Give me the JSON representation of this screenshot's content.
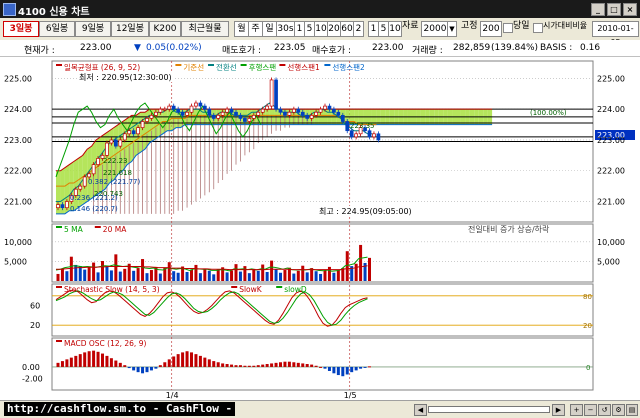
{
  "window": {
    "title": "4100 신용 차트"
  },
  "toolbar": {
    "tabs": [
      "3일봉",
      "6일봉",
      "9일봉",
      "12일봉",
      "K200",
      "최근월물"
    ],
    "period_buttons": [
      "월",
      "주",
      "일",
      "30s",
      "1",
      "5",
      "10",
      "20",
      "60",
      "2"
    ],
    "range_buttons": [
      "1",
      "5",
      "10"
    ],
    "count_label": "자료",
    "count_value": "2000",
    "fixed_label": "고정",
    "fixed_value": "200",
    "today_label": "당일",
    "compare_label": "시가대비비율",
    "date_value": "2010-01-05"
  },
  "info": {
    "current_label": "현재가 :",
    "current_value": "223.00",
    "change_value": "0.05(0.02%)",
    "sell_label": "매도호가 :",
    "sell_value": "223.05",
    "buy_label": "매수호가 :",
    "buy_value": "223.00",
    "volume_label": "거래량 :",
    "volume_value": "282,859",
    "volume_pct": "(139.84%)",
    "basis_label": "BASIS :",
    "basis_value": "0.16"
  },
  "legend": {
    "main": [
      {
        "name": "일목균형표 (26, 9, 52)",
        "color": "#c00000"
      },
      {
        "name": "기준선",
        "color": "#e08000"
      },
      {
        "name": "전환선",
        "color": "#008080"
      },
      {
        "name": "후행스팬",
        "color": "#00a000"
      },
      {
        "name": "선행스팬1",
        "color": "#c00000"
      },
      {
        "name": "선행스팬2",
        "color": "#0066cc"
      }
    ],
    "volume": [
      {
        "name": "5 MA",
        "color": "#00a000"
      },
      {
        "name": "20 MA",
        "color": "#c00000"
      }
    ],
    "volume_note": "전일대비 증가 상승/하락",
    "stoch": [
      {
        "name": "Stochastic Slow (14, 5, 3)",
        "color": "#c00000"
      },
      {
        "name": "SlowK",
        "color": "#c00000"
      },
      {
        "name": "slowD",
        "color": "#00a000"
      }
    ],
    "macd": [
      {
        "name": "MACD OSC (12, 26, 9)",
        "color": "#c00000"
      }
    ]
  },
  "annotations": {
    "high": "최고 : 224.95(09:05:00)",
    "low": "최저 : 220.95(12:30:00)",
    "cloud_labels": [
      "222.23",
      "221.618",
      "220.743",
      "223.35"
    ],
    "fib_labels": [
      "0.382 (221.77)",
      "0.236 (221.2)",
      "0.146 (220.7)"
    ],
    "right_box_label": "(100.00%)"
  },
  "price_badge": "223.00",
  "axes": {
    "price_ticks": [
      "225.00",
      "224.00",
      "223.00",
      "222.00",
      "221.00"
    ],
    "volume_ticks": [
      "10,000",
      "5,000"
    ],
    "stoch_ticks": [
      "60",
      "20"
    ],
    "stoch_levels": [
      "80",
      "20"
    ],
    "macd_ticks": [
      "0.00",
      "-2.00"
    ],
    "macd_zero": "0",
    "date_ticks": [
      "1/4",
      "1/5"
    ]
  },
  "statusbar": {
    "watermark": "http://cashflow.sm.to - CashFlow -"
  },
  "colors": {
    "background": "#ffffff",
    "cloud_fill": "#a8e040",
    "cloud_neg": "#b07878",
    "candle_up": "#c00000",
    "candle_down": "#0040c0",
    "grid": "#b0b0b0"
  },
  "chart_data": [
    {
      "type": "candlestick",
      "title": "일목균형표 (26, 9, 52)",
      "yticks": [
        221,
        222,
        223,
        224,
        225
      ],
      "ylim": [
        220.4,
        225.5
      ],
      "x_range": [
        0,
        120
      ],
      "date_ticks": [
        {
          "x": 26,
          "label": "1/4"
        },
        {
          "x": 66,
          "label": "1/5"
        }
      ],
      "horizontal_lines": [
        224.0,
        223.75,
        223.55,
        223.1,
        222.95
      ],
      "price_close": [
        220.9,
        220.8,
        221.0,
        221.2,
        221.4,
        221.5,
        221.8,
        221.9,
        222.2,
        222.4,
        222.5,
        222.9,
        223.0,
        222.8,
        223.0,
        223.2,
        223.3,
        223.2,
        223.4,
        223.6,
        223.7,
        223.8,
        223.9,
        224.0,
        224.0,
        224.1,
        224.0,
        223.9,
        223.8,
        223.9,
        224.1,
        224.2,
        224.1,
        224.0,
        223.8,
        223.7,
        223.8,
        223.9,
        224.0,
        223.9,
        223.8,
        223.7,
        223.6,
        223.7,
        223.8,
        223.9,
        224.0,
        224.1,
        224.95,
        224.0,
        223.9,
        223.8,
        223.9,
        224.0,
        223.9,
        223.8,
        223.7,
        223.8,
        223.9,
        224.0,
        224.1,
        224.0,
        223.9,
        223.8,
        223.6,
        223.3,
        223.1,
        223.2,
        223.4,
        223.3,
        223.1,
        223.2,
        223.0
      ],
      "tenkan": [
        221.0,
        221.0,
        221.1,
        221.2,
        221.4,
        221.5,
        221.7,
        221.9,
        222.1,
        222.3,
        222.5,
        222.7,
        222.9,
        223.0,
        223.1,
        223.2,
        223.3,
        223.4,
        223.5,
        223.6,
        223.7,
        223.8,
        223.8,
        223.9,
        223.9,
        224.0,
        224.0,
        223.9,
        223.9,
        223.9,
        224.0,
        224.0,
        224.0,
        223.9,
        223.9,
        223.8,
        223.8,
        223.9,
        223.9,
        223.9,
        223.8,
        223.8,
        223.8,
        223.8,
        223.9,
        223.9,
        224.0,
        224.1,
        224.2,
        224.1,
        224.0,
        223.9,
        223.9,
        223.9,
        223.9,
        223.8,
        223.8,
        223.8,
        223.9,
        223.9,
        224.0,
        223.9,
        223.9,
        223.8,
        223.7,
        223.5,
        223.4,
        223.3,
        223.3,
        223.3,
        223.2,
        223.2,
        223.1
      ],
      "kijun": [
        221.5,
        221.5,
        221.5,
        221.6,
        221.6,
        221.7,
        221.8,
        221.9,
        222.0,
        222.1,
        222.2,
        222.3,
        222.4,
        222.5,
        222.6,
        222.7,
        222.8,
        222.9,
        223.0,
        223.1,
        223.2,
        223.3,
        223.4,
        223.5,
        223.6,
        223.6,
        223.7,
        223.7,
        223.7,
        223.7,
        223.8,
        223.8,
        223.8,
        223.8,
        223.8,
        223.8,
        223.8,
        223.8,
        223.8,
        223.8,
        223.8,
        223.8,
        223.8,
        223.8,
        223.8,
        223.8,
        223.8,
        223.8,
        223.8,
        223.8,
        223.8,
        223.8,
        223.8,
        223.8,
        223.8,
        223.8,
        223.8,
        223.8,
        223.8,
        223.8,
        223.8,
        223.8,
        223.8,
        223.8,
        223.7,
        223.6,
        223.6,
        223.6,
        223.5,
        223.5,
        223.5,
        223.5,
        223.5
      ],
      "chikou": [
        221.8,
        222.2,
        222.6,
        223.0,
        223.5,
        223.9,
        224.0,
        224.1,
        223.9,
        223.6,
        223.4,
        223.5,
        223.8,
        224.0,
        223.7,
        223.5,
        223.3,
        223.6,
        223.9,
        224.1,
        224.2,
        224.0,
        223.8,
        223.6,
        223.4,
        223.6,
        223.9,
        224.0,
        223.8,
        223.5,
        223.3,
        223.6,
        223.9,
        224.1,
        223.8,
        223.5,
        223.2,
        223.4,
        223.7,
        223.9,
        223.6,
        223.3,
        223.1,
        223.3,
        223.6,
        223.8,
        223.5
      ],
      "span_a": [
        222.0,
        222.0,
        222.1,
        222.2,
        222.3,
        222.4,
        222.5,
        222.7,
        222.8,
        223.0,
        223.1,
        223.2,
        223.3,
        223.4,
        223.5,
        223.6,
        223.7,
        223.8,
        223.8,
        223.9,
        223.9,
        224.0,
        224.0,
        224.0,
        224.0,
        224.0,
        224.0,
        224.0,
        224.0,
        224.0,
        224.0,
        224.0,
        224.0,
        224.0,
        224.0,
        224.0,
        224.0,
        224.0,
        224.0,
        224.0,
        224.0,
        224.0,
        224.0,
        224.0,
        224.0,
        224.0,
        224.0,
        224.0,
        224.0,
        224.0,
        224.0,
        224.0,
        224.0,
        224.0,
        224.0,
        224.0,
        224.0,
        224.0,
        224.0,
        224.0,
        224.0,
        224.0,
        224.0,
        224.0,
        224.0,
        224.0,
        224.0,
        224.0,
        224.0,
        224.0,
        224.0,
        224.0,
        224.0,
        224.0,
        224.0,
        224.0,
        224.0,
        224.0,
        224.0,
        224.0,
        224.0,
        224.0,
        224.0,
        224.0,
        224.0,
        224.0,
        224.0,
        224.0,
        224.0,
        224.0,
        224.0,
        224.0,
        224.0,
        224.0,
        224.0,
        224.0,
        224.0,
        224.0,
        224.0
      ],
      "span_b": [
        220.6,
        220.6,
        220.6,
        220.7,
        220.7,
        220.8,
        220.9,
        221.0,
        221.1,
        221.2,
        221.3,
        221.4,
        221.6,
        221.7,
        221.9,
        222.0,
        222.2,
        222.3,
        222.5,
        222.6,
        222.7,
        222.9,
        223.0,
        223.1,
        223.2,
        223.3,
        223.3,
        223.4,
        223.4,
        223.5,
        223.5,
        223.5,
        223.5,
        223.5,
        223.5,
        223.5,
        223.5,
        223.5,
        223.5,
        223.5,
        223.5,
        223.5,
        223.5,
        223.5,
        223.5,
        223.5,
        223.5,
        223.5,
        223.5,
        223.5,
        223.5,
        223.5,
        223.5,
        223.5,
        223.5,
        223.5,
        223.5,
        223.5,
        223.5,
        223.5,
        223.5,
        223.5,
        223.5,
        223.5,
        223.5,
        223.5,
        223.5,
        223.5,
        223.5,
        223.5,
        223.5,
        223.5,
        223.5,
        223.5,
        223.5,
        223.5,
        223.5,
        223.5,
        223.5,
        223.5,
        223.5,
        223.5,
        223.5,
        223.5,
        223.5,
        223.5,
        223.5,
        223.5,
        223.5,
        223.5,
        223.5,
        223.5,
        223.5,
        223.5,
        223.5,
        223.5,
        223.5,
        223.5,
        223.5
      ]
    },
    {
      "type": "bar",
      "title": "volume",
      "yticks": [
        5000,
        10000
      ],
      "ylim": [
        0,
        12500
      ],
      "values": [
        1800,
        3200,
        2500,
        6200,
        4100,
        3800,
        2900,
        3500,
        4700,
        2200,
        5100,
        3900,
        2700,
        6800,
        2400,
        3100,
        4400,
        2600,
        3300,
        5600,
        2000,
        2800,
        3600,
        1900,
        3400,
        4800,
        2500,
        2100,
        3700,
        2300,
        2900,
        4100,
        2000,
        3200,
        2600,
        1700,
        2900,
        3500,
        2200,
        2700,
        4300,
        2400,
        3800,
        2000,
        3100,
        2600,
        4200,
        2300,
        5200,
        3000,
        2100,
        2800,
        3400,
        1900,
        2600,
        3900,
        2200,
        3300,
        2500,
        1800,
        2700,
        3600,
        2100,
        2900,
        3300,
        7600,
        3800,
        4400,
        9200,
        4600,
        5900
      ],
      "ma5": [
        2800,
        3000,
        3400,
        3600,
        3900,
        3800,
        3600,
        3700,
        3600,
        3500,
        3700,
        3900,
        3800,
        4100,
        3900,
        3700,
        3800,
        3600,
        3400,
        3700,
        3300,
        3200,
        3300,
        2900,
        2800,
        3300,
        3200,
        3000,
        3200,
        3100,
        2700,
        3100,
        3100,
        3000,
        3000,
        2700,
        2700,
        2900,
        2800,
        2600,
        3100,
        3000,
        3100,
        2900,
        3100,
        2800,
        3100,
        3000,
        3500,
        3500,
        3300,
        3000,
        3300,
        2900,
        2800,
        2900,
        2800,
        3000,
        2900,
        2700,
        2600,
        2800,
        2500,
        2600,
        2900,
        3900,
        4100,
        4400,
        5700,
        5900,
        6100
      ],
      "ma20": [
        3000,
        3000,
        3100,
        3200,
        3300,
        3400,
        3400,
        3500,
        3500,
        3500,
        3600,
        3600,
        3700,
        3700,
        3700,
        3700,
        3700,
        3700,
        3700,
        3700,
        3600,
        3600,
        3500,
        3400,
        3400,
        3400,
        3300,
        3300,
        3300,
        3200,
        3200,
        3200,
        3100,
        3100,
        3100,
        3000,
        3000,
        3000,
        3000,
        2900,
        2900,
        2900,
        2900,
        2900,
        2900,
        2900,
        2900,
        2900,
        3000,
        3000,
        3000,
        3000,
        3000,
        2900,
        2900,
        2900,
        2900,
        2900,
        2900,
        2900,
        2900,
        2900,
        2900,
        2900,
        2900,
        3100,
        3200,
        3300,
        3600,
        3700,
        3900
      ]
    },
    {
      "type": "line",
      "title": "Stochastic Slow (14, 5, 3)",
      "yticks": [
        20,
        60
      ],
      "ylim": [
        0,
        100
      ],
      "levels": [
        80,
        20
      ],
      "slow_k": [
        72,
        78,
        84,
        90,
        92,
        88,
        80,
        72,
        66,
        68,
        78,
        86,
        90,
        88,
        82,
        74,
        66,
        58,
        50,
        42,
        38,
        44,
        54,
        66,
        78,
        86,
        88,
        84,
        76,
        66,
        56,
        48,
        44,
        46,
        52,
        60,
        70,
        80,
        88,
        90,
        86,
        78,
        70,
        62,
        54,
        46,
        38,
        30,
        24,
        22,
        30,
        44,
        60,
        76,
        86,
        90,
        84,
        72,
        56,
        38,
        24,
        18,
        20,
        30,
        44,
        56,
        62,
        66,
        70,
        74,
        76
      ],
      "slow_d": [
        70,
        74,
        78,
        84,
        88,
        90,
        86,
        80,
        74,
        70,
        72,
        78,
        84,
        88,
        86,
        82,
        74,
        66,
        58,
        50,
        42,
        40,
        46,
        56,
        66,
        76,
        84,
        86,
        82,
        74,
        64,
        54,
        48,
        46,
        48,
        54,
        62,
        72,
        80,
        86,
        88,
        84,
        76,
        68,
        60,
        52,
        44,
        36,
        28,
        24,
        26,
        34,
        46,
        60,
        74,
        84,
        88,
        82,
        70,
        54,
        38,
        26,
        20,
        22,
        30,
        42,
        52,
        60,
        66,
        70,
        74
      ]
    },
    {
      "type": "bar",
      "title": "MACD OSC (12, 26, 9)",
      "yticks": [
        -2,
        0
      ],
      "ylim": [
        -3.8,
        3.6
      ],
      "values": [
        0.7,
        1.0,
        1.3,
        1.6,
        1.9,
        2.2,
        2.5,
        2.7,
        2.8,
        2.6,
        2.3,
        1.9,
        1.5,
        1.1,
        0.7,
        0.3,
        -0.2,
        -0.6,
        -0.9,
        -1.1,
        -0.9,
        -0.6,
        -0.3,
        0.3,
        0.8,
        1.3,
        1.8,
        2.2,
        2.5,
        2.7,
        2.5,
        2.2,
        1.9,
        1.6,
        1.3,
        1.0,
        0.8,
        0.6,
        0.5,
        0.4,
        0.3,
        0.3,
        0.2,
        0.2,
        0.2,
        0.3,
        0.4,
        0.5,
        0.6,
        0.7,
        0.8,
        0.9,
        0.9,
        0.8,
        0.7,
        0.6,
        0.5,
        0.4,
        0.2,
        0.0,
        -0.3,
        -0.7,
        -1.1,
        -1.4,
        -1.6,
        -1.3,
        -0.9,
        -0.6,
        -0.3,
        -0.1,
        0.1
      ]
    }
  ]
}
